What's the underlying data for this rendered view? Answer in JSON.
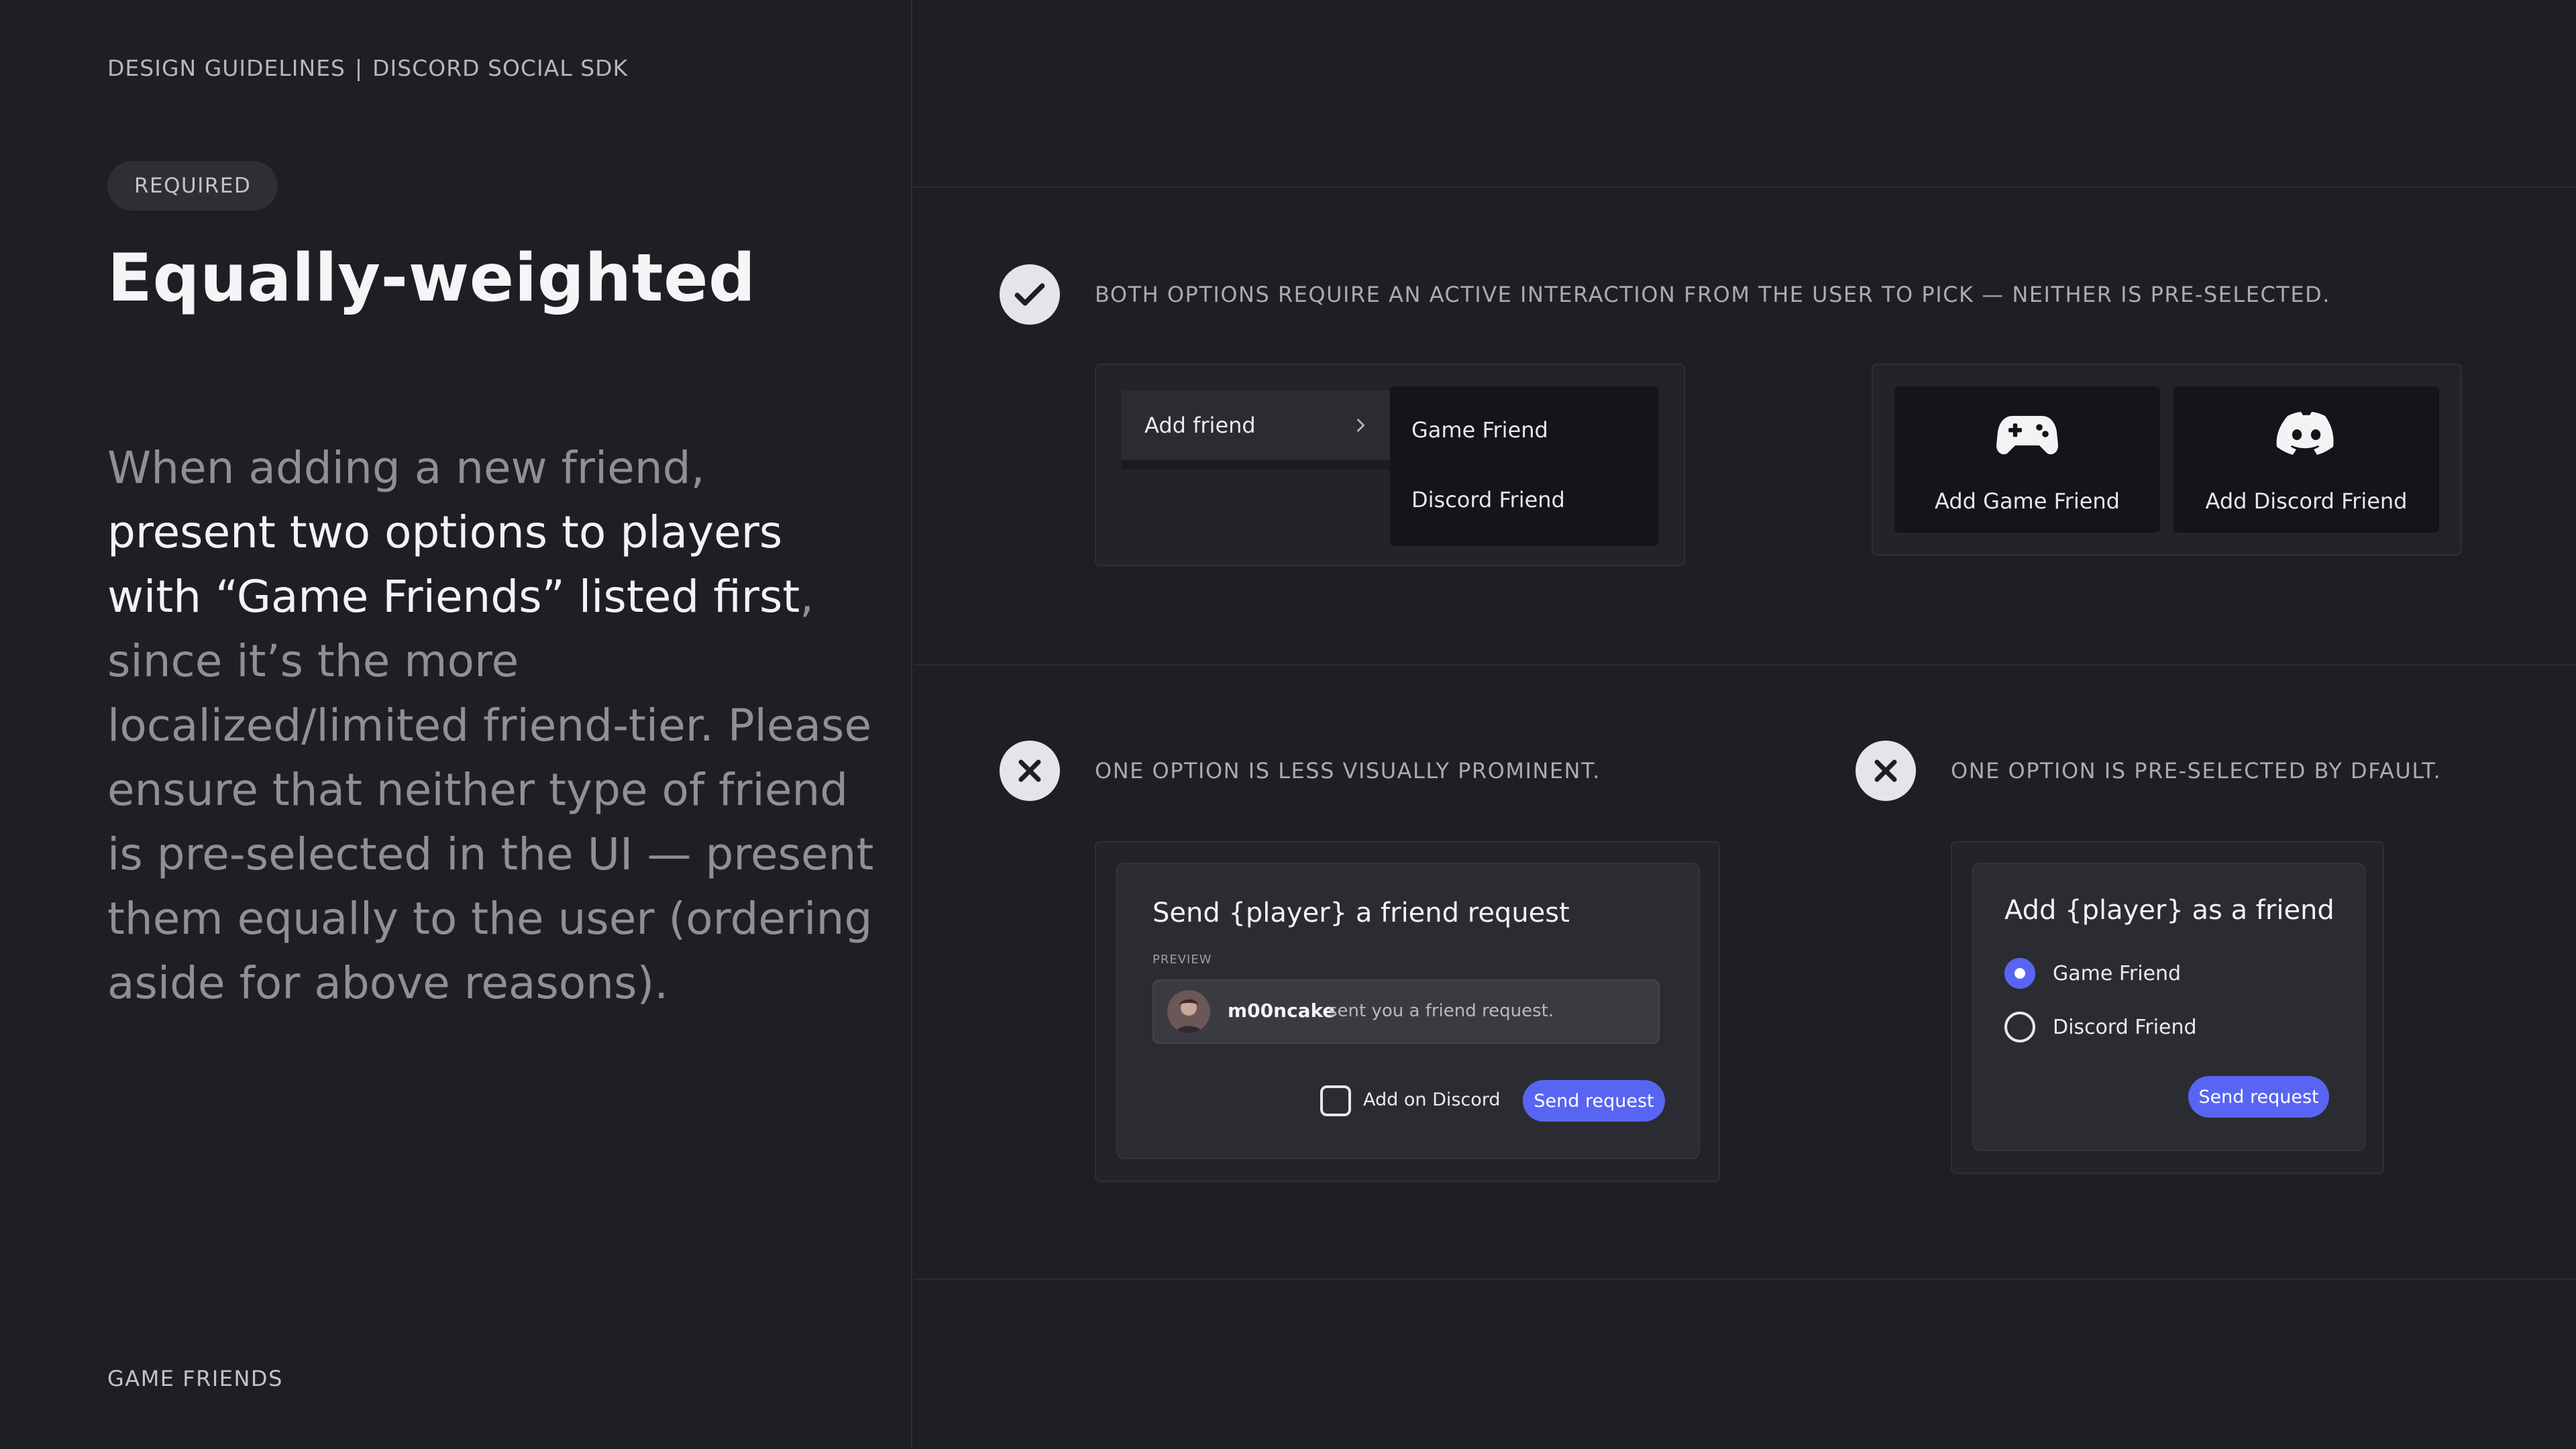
{
  "header": {
    "section": "DESIGN GUIDELINES",
    "separator": "|",
    "product": "DISCORD SOCIAL SDK"
  },
  "badge": "REQUIRED",
  "title": "Equally-weighted",
  "body": {
    "p1": "When adding a new friend, ",
    "b1": "present two options to players with “Game Friends” listed first",
    "p2": ", since it’s the more localized/limited friend-tier. Please ensure that neither type of friend is pre-selected in the UI — present them equally to the user (ordering aside for above reasons)."
  },
  "footer": "GAME FRIENDS",
  "colors": {
    "background": "#1e1f23",
    "accent": "#5865f2",
    "panel": "#2b2c31"
  },
  "examples": {
    "good": {
      "status": "do",
      "icon": "checkmark-icon",
      "caption": "BOTH OPTIONS REQUIRE AN ACTIVE INTERACTION FROM THE USER TO PICK — NEITHER IS PRE-SELECTED.",
      "menu": {
        "trigger": "Add friend",
        "items": [
          "Game Friend",
          "Discord Friend"
        ]
      },
      "tiles": [
        {
          "icon": "gamepad-icon",
          "label": "Add Game Friend"
        },
        {
          "icon": "discord-logo-icon",
          "label": "Add Discord Friend"
        }
      ]
    },
    "bad_prominence": {
      "status": "dont",
      "icon": "x-icon",
      "caption": "ONE OPTION IS LESS VISUALLY PROMINENT.",
      "dialog": {
        "title": "Send {player} a friend request",
        "preview_label": "PREVIEW",
        "username": "m00ncake",
        "message": "sent you a friend request.",
        "checkbox_label": "Add on Discord",
        "button": "Send request"
      }
    },
    "bad_preselected": {
      "status": "dont",
      "icon": "x-icon",
      "caption": "ONE OPTION IS PRE-SELECTED BY DFAULT.",
      "dialog": {
        "title": "Add {player} as a friend",
        "options": [
          "Game Friend",
          "Discord Friend"
        ],
        "selected": "Game Friend",
        "button": "Send request"
      }
    }
  }
}
